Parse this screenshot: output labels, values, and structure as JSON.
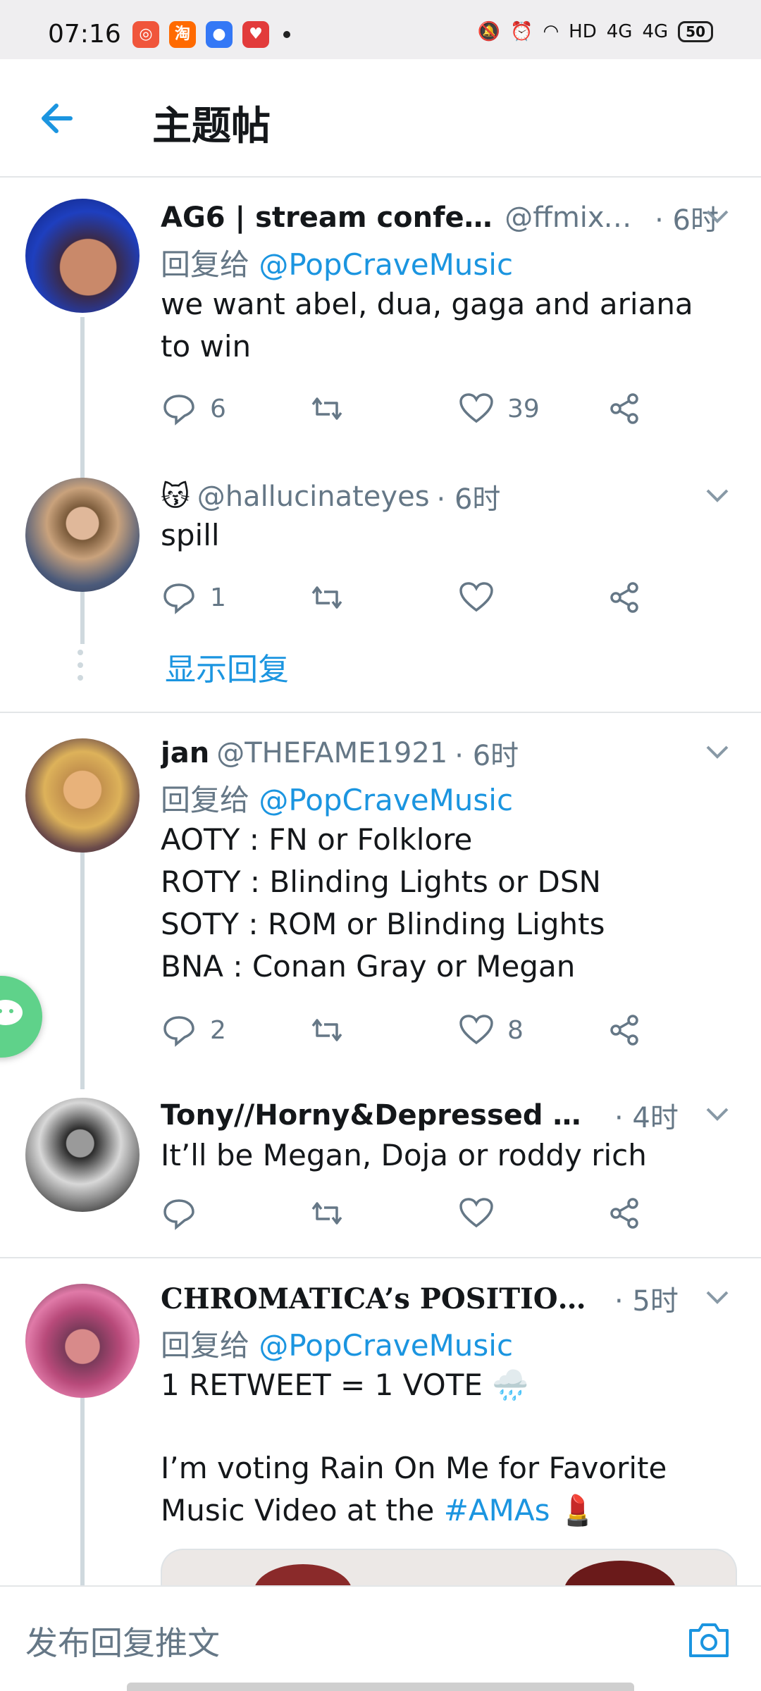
{
  "status_bar": {
    "time": "07:16",
    "network_label": "HD",
    "signal_1": "4G",
    "signal_2": "4G",
    "battery": "50"
  },
  "header": {
    "title": "主题帖"
  },
  "tweets": [
    {
      "name": "AG6 | stream confetti",
      "handle": "@ffmixe…",
      "time": "· 6时",
      "reply_prefix": "回复给 ",
      "reply_to": "@PopCraveMusic",
      "text": "we want abel, dua, gaga and ariana to win",
      "reply_count": "6",
      "retweet_count": "",
      "like_count": "39"
    },
    {
      "name": "😽",
      "handle": "@hallucinateyes",
      "time": "· 6时",
      "text": "spill",
      "reply_count": "1",
      "like_count": "",
      "show_replies": "显示回复"
    },
    {
      "name": "jan",
      "handle": "@THEFAME1921",
      "time": "· 6时",
      "reply_prefix": "回复给 ",
      "reply_to": "@PopCraveMusic",
      "text": "AOTY : FN or Folklore\nROTY : Blinding Lights or DSN\nSOTY : ROM or Blinding Lights\nBNA : Conan Gray or Megan",
      "reply_count": "2",
      "like_count": "8"
    },
    {
      "name": "Tony//Horny&Depressed era …",
      "handle": "",
      "time": "· 4时",
      "text": "It’ll be Megan, Doja or roddy rich",
      "reply_count": "",
      "like_count": ""
    },
    {
      "name": "CHROMATICA’s POSITIONS …",
      "handle": "",
      "time": "· 5时",
      "reply_prefix": "回复给 ",
      "reply_to": "@PopCraveMusic",
      "text_line1": "1 RETWEET = 1 VOTE 🌧️",
      "text_line2": "I’m voting Rain On Me for Favorite Music Video at the ",
      "hashtag": "#AMAs",
      "text_tail": " 💄"
    }
  ],
  "compose": {
    "placeholder": "发布回复推文"
  },
  "colors": {
    "accent": "#1b95e0",
    "muted": "#657786",
    "line": "#cfd9de"
  },
  "icons": [
    "back-arrow-icon",
    "chevron-down-icon",
    "reply-icon",
    "retweet-icon",
    "like-icon",
    "share-icon",
    "camera-icon",
    "wechat-icon"
  ]
}
